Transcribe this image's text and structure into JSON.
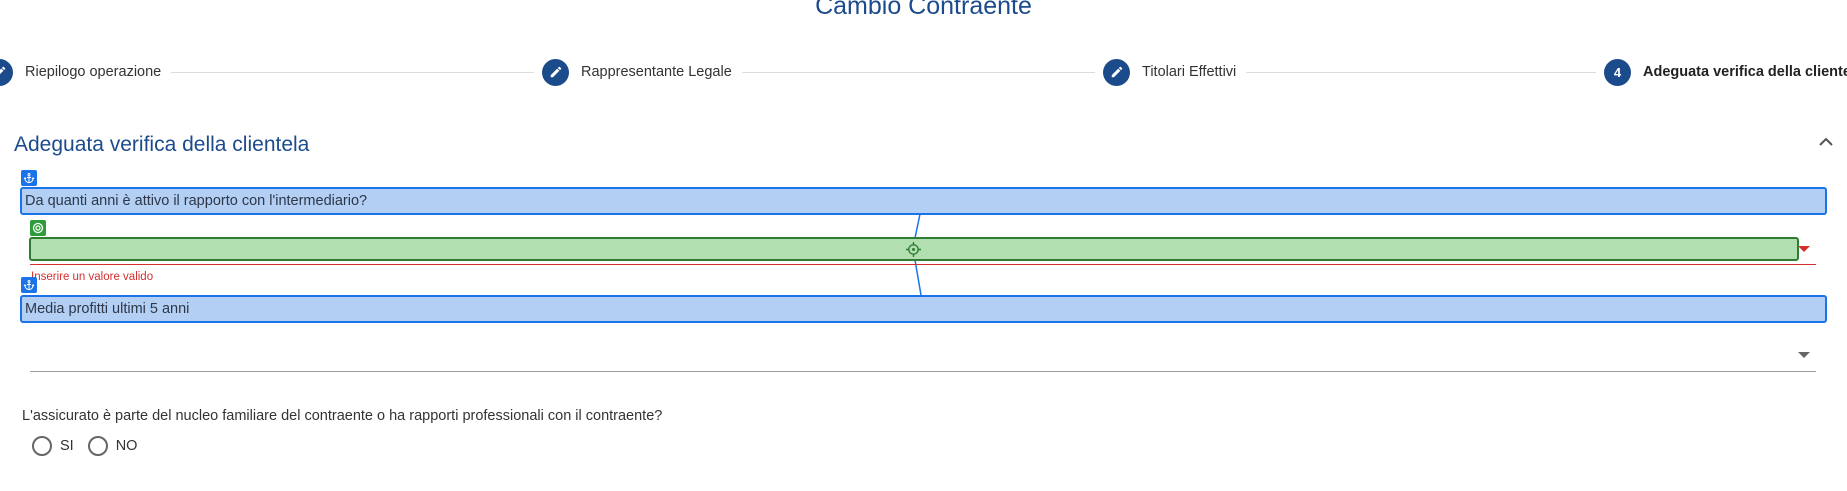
{
  "page": {
    "title": "Cambio Contraente"
  },
  "stepper": {
    "steps": [
      {
        "label": "Riepilogo operazione",
        "icon": "pencil-icon",
        "state": "completed"
      },
      {
        "label": "Rappresentante Legale",
        "icon": "pencil-icon",
        "state": "completed"
      },
      {
        "label": "Titolari Effettivi",
        "icon": "pencil-icon",
        "state": "completed"
      },
      {
        "label": "Adeguata verifica della cliente",
        "number": "4",
        "state": "active"
      }
    ]
  },
  "section": {
    "title": "Adeguata verifica della clientela",
    "collapse_icon": "chevron-up-icon"
  },
  "fields": {
    "years_question": "Da quanti anni è attivo il rapporto con l'intermediario?",
    "years_value": "",
    "years_error": "Inserire un valore valido",
    "profits_label": "Media profitti ultimi 5 anni",
    "profits_value": ""
  },
  "relationship": {
    "question": "L'assicurato è parte del nucleo familiare del contraente o ha rapporti professionali con il contraente?",
    "options": [
      "SI",
      "NO"
    ]
  },
  "colors": {
    "primary": "#1c4b8c",
    "error": "#d32f2f",
    "overlay_blue": "#1a73e8",
    "overlay_green": "#2e7d32"
  }
}
